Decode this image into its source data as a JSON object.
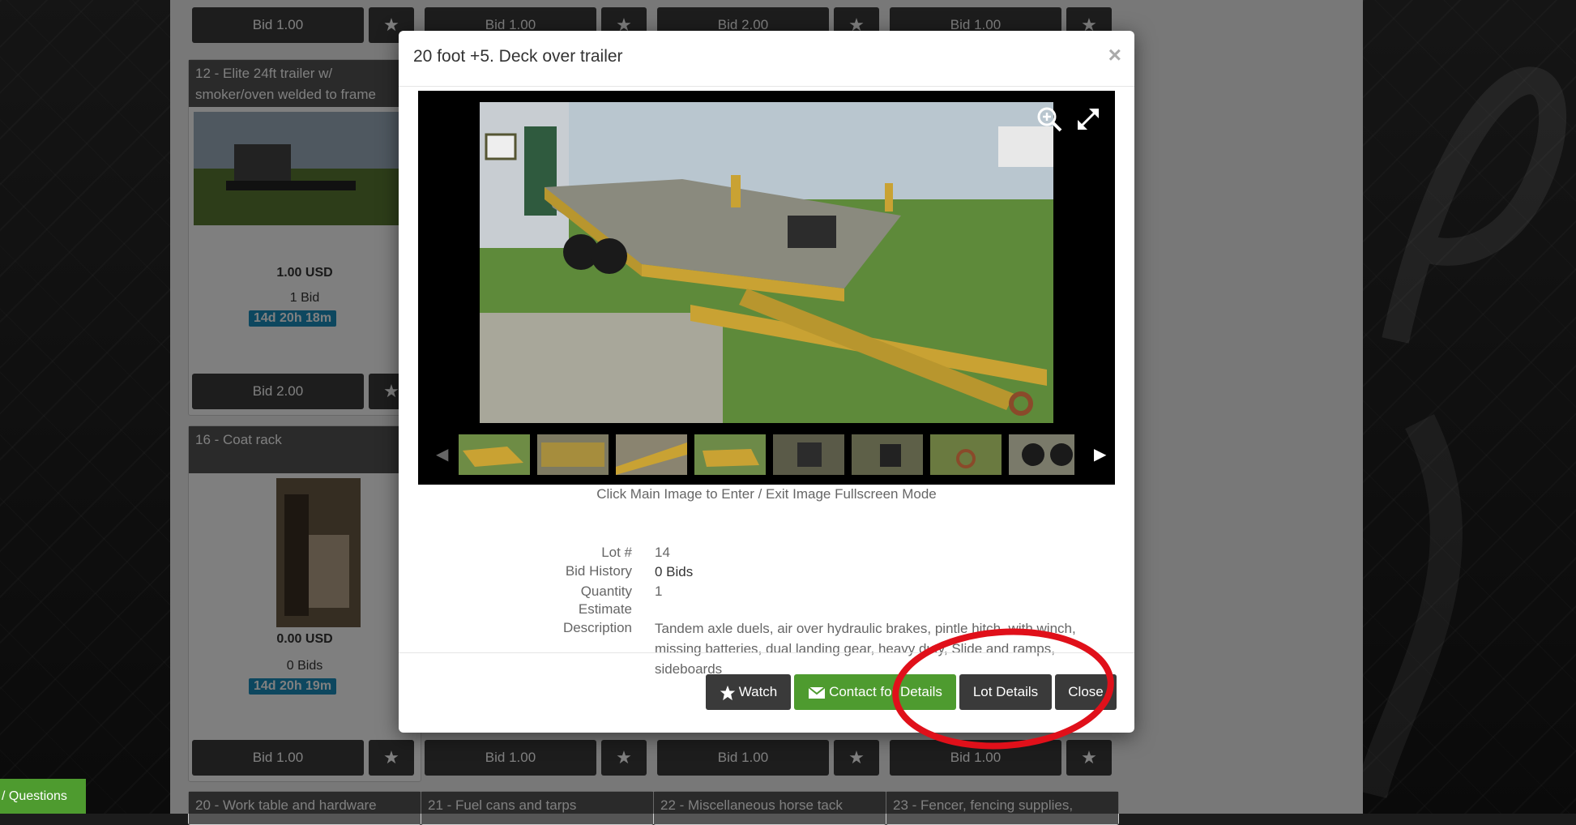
{
  "background_cards": {
    "row0_bids": [
      "Bid 1.00",
      "Bid 1.00",
      "Bid 2.00",
      "Bid 1.00"
    ],
    "card12": {
      "title": "12 - Elite 24ft trailer w/ smoker/oven welded to frame",
      "price": "1.00 USD",
      "bids": "1 Bid",
      "timer": "14d 20h 18m",
      "bid_label": "Bid 2.00"
    },
    "card16": {
      "title": "16 - Coat rack",
      "price": "0.00 USD",
      "bids": "0 Bids",
      "timer": "14d 20h 19m"
    },
    "row2_bids": [
      "Bid 1.00",
      "Bid 1.00",
      "Bid 1.00",
      "Bid 1.00"
    ],
    "bottom_titles": [
      "20 - Work table and hardware",
      "21 - Fuel cans and tarps",
      "22 - Miscellaneous horse tack",
      "23 - Fencer, fencing supplies,"
    ]
  },
  "side_tab": {
    "label": "/ Questions"
  },
  "modal": {
    "title": "20 foot +5. Deck over trailer",
    "close_x": "×",
    "hint": "Click Main Image to Enter / Exit Image Fullscreen Mode",
    "details": {
      "lot_label": "Lot #",
      "lot_value": "14",
      "bid_history_label": "Bid History",
      "bid_history_value": "0 Bids",
      "quantity_label": "Quantity",
      "quantity_value": "1",
      "estimate_label": "Estimate",
      "description_label": "Description",
      "description_value": "Tandem axle duels, air over hydraulic brakes, pintle hitch, with winch, missing batteries, dual landing gear, heavy duty, Slide and ramps, sideboards"
    },
    "buttons": {
      "watch": "Watch",
      "contact": "Contact for Details",
      "lot_details": "Lot Details",
      "close": "Close"
    }
  },
  "colors": {
    "accent_green": "#4e9b2f",
    "timer_blue": "#1a8fbf",
    "dark_button": "#3a3a3a",
    "annotation_red": "#e0101a"
  },
  "icons": [
    "star-icon",
    "envelope-icon",
    "zoom-in-icon",
    "fullscreen-icon",
    "chevron-left-icon",
    "chevron-right-icon",
    "close-icon"
  ]
}
